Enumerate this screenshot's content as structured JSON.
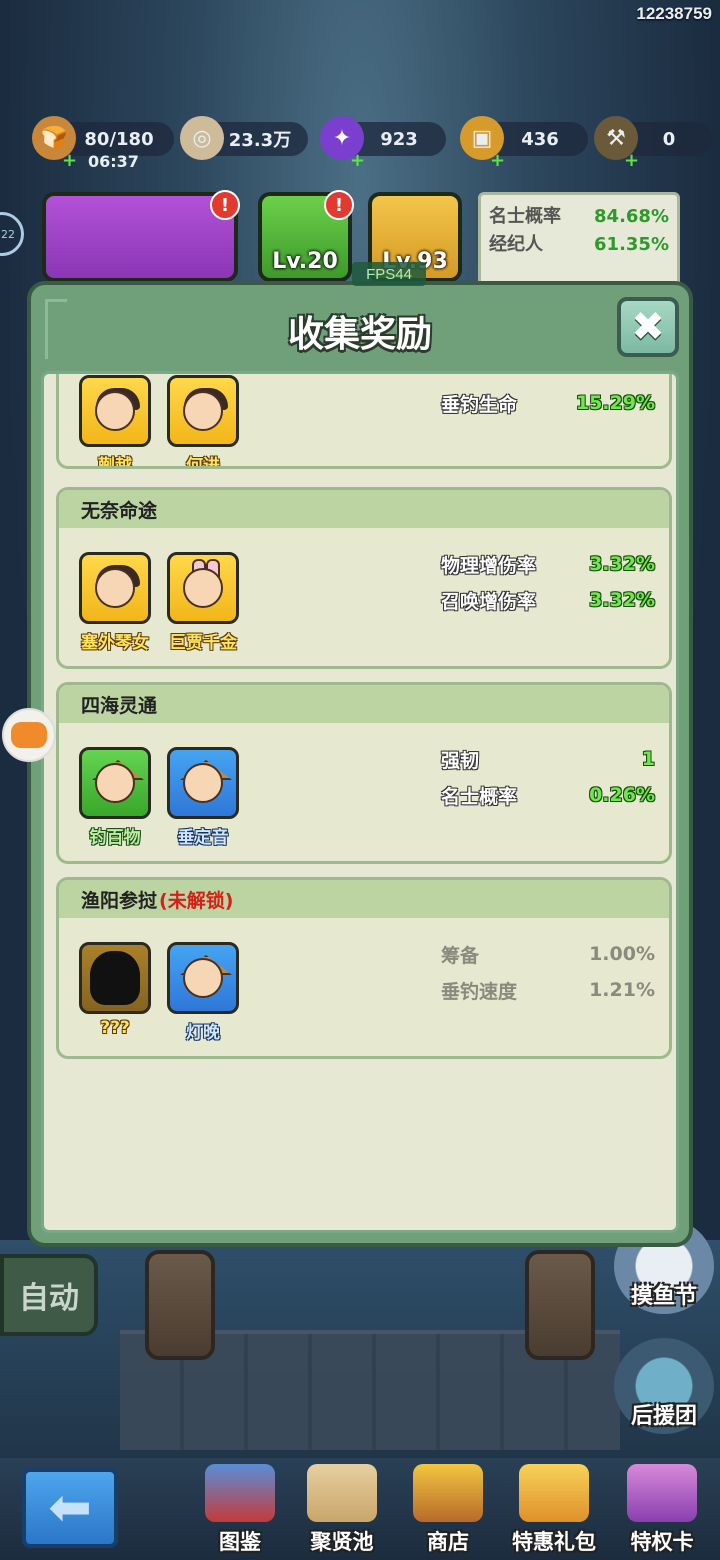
{
  "user_id": "12238759",
  "fps": "FPS44",
  "resources": {
    "stamina": {
      "value": "80/180",
      "timer": "06:37"
    },
    "coins": {
      "value": "23.3万"
    },
    "gems": {
      "value": "923"
    },
    "tokens": {
      "value": "436"
    },
    "rods": {
      "value": "0"
    }
  },
  "top_cards": {
    "alert": "!",
    "rope_level": "Lv.20",
    "bait_level": "Lv.93"
  },
  "stats_panel": [
    {
      "label": "名士概率",
      "value": "84.68%"
    },
    {
      "label": "经纪人",
      "value": "61.35%"
    }
  ],
  "modal": {
    "title": "收集奖励",
    "close": "✖",
    "sets": [
      {
        "name": "",
        "heroes": [
          {
            "name": "蒯越",
            "rarity": "gold"
          },
          {
            "name": "何进",
            "rarity": "gold"
          }
        ],
        "bonuses": [
          {
            "label": "垂钓生命",
            "value": "15.29%"
          }
        ]
      },
      {
        "name": "无奈命途",
        "heroes": [
          {
            "name": "塞外琴女",
            "rarity": "gold"
          },
          {
            "name": "巨贾千金",
            "rarity": "gold"
          }
        ],
        "bonuses": [
          {
            "label": "物理增伤率",
            "value": "3.32%"
          },
          {
            "label": "召唤增伤率",
            "value": "3.32%"
          }
        ]
      },
      {
        "name": "四海灵通",
        "heroes": [
          {
            "name": "钓百物",
            "rarity": "green"
          },
          {
            "name": "垂定音",
            "rarity": "blue"
          }
        ],
        "bonuses": [
          {
            "label": "强韧",
            "value": "1"
          },
          {
            "label": "名士概率",
            "value": "0.26%"
          }
        ]
      },
      {
        "name": "渔阳参挝",
        "locked_label": "(未解锁)",
        "heroes": [
          {
            "name": "???",
            "rarity": "unknown"
          },
          {
            "name": "灯晚",
            "rarity": "blue"
          }
        ],
        "bonuses": [
          {
            "label": "筹备",
            "value": "1.00%"
          },
          {
            "label": "垂钓速度",
            "value": "1.21%"
          }
        ]
      }
    ]
  },
  "side": {
    "auto": "自动",
    "fish_festival": "摸鱼节",
    "support": "后援团"
  },
  "nav": {
    "back_icon": "back-arrow-icon",
    "items": [
      {
        "label": "图鉴",
        "icon": "book-icon"
      },
      {
        "label": "聚贤池",
        "icon": "scroll-icon"
      },
      {
        "label": "商店",
        "icon": "shop-icon"
      },
      {
        "label": "特惠礼包",
        "icon": "gift-icon"
      },
      {
        "label": "特权卡",
        "icon": "card-icon"
      }
    ]
  },
  "colors": {
    "modal_frame": "#6fa07a",
    "set_header": "#bcd3a2",
    "bonus_value": "#6ee84c",
    "locked": "#d61f17"
  }
}
